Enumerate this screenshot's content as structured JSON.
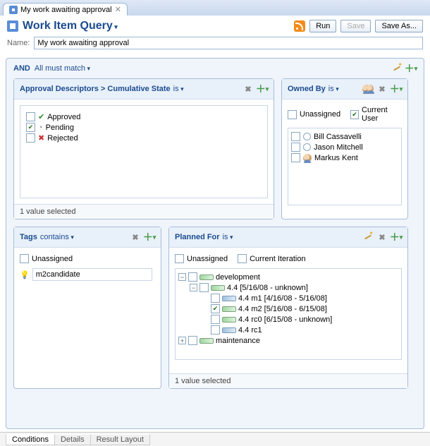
{
  "tab": {
    "title": "My work awaiting approval"
  },
  "header": {
    "title": "Work Item Query",
    "run": "Run",
    "save": "Save",
    "save_as": "Save As..."
  },
  "name_row": {
    "label": "Name:",
    "value": "My work awaiting approval"
  },
  "and_row": {
    "and": "AND",
    "match": "All must match"
  },
  "approval": {
    "title": "Approval Descriptors > Cumulative State",
    "op": "is",
    "items": [
      {
        "label": "Approved",
        "checked": false
      },
      {
        "label": "Pending",
        "checked": true
      },
      {
        "label": "Rejected",
        "checked": false
      }
    ],
    "footer": "1 value selected"
  },
  "owned": {
    "title": "Owned By",
    "op": "is",
    "unassigned": "Unassigned",
    "current": "Current User",
    "users": [
      "Bill Cassavelli",
      "Jason Mitchell",
      "Markus Kent"
    ]
  },
  "tags": {
    "title": "Tags",
    "op": "contains",
    "unassigned": "Unassigned",
    "input": "m2candidate"
  },
  "planned": {
    "title": "Planned For",
    "op": "is",
    "unassigned": "Unassigned",
    "current_iter": "Current Iteration",
    "tree": {
      "dev": "development",
      "v44": "4.4 [5/16/08 - unknown]",
      "m1": "4.4 m1 [4/16/08 - 5/16/08]",
      "m2": "4.4 m2 [5/16/08 - 6/15/08]",
      "rc0": "4.4 rc0 [6/15/08 - unknown]",
      "rc1": "4.4 rc1",
      "maint": "maintenance"
    },
    "footer": "1 value selected"
  },
  "footer_tabs": {
    "a": "Conditions",
    "b": "Details",
    "c": "Result Layout"
  }
}
